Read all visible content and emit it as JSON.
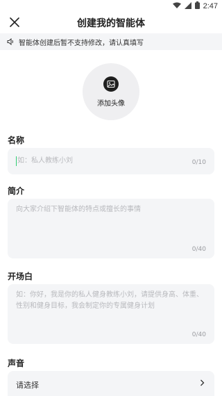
{
  "status_bar": {
    "time": "2:47"
  },
  "header": {
    "title": "创建我的智能体"
  },
  "notice": {
    "text": "智能体创建后暂不支持修改，请认真填写"
  },
  "avatar": {
    "label": "添加头像"
  },
  "name_field": {
    "label": "名称",
    "placeholder": "如：私人教练小刘",
    "count": "0/10"
  },
  "intro_field": {
    "label": "简介",
    "placeholder": "向大家介绍下智能体的特点或擅长的事情",
    "count": "0/40"
  },
  "opening_field": {
    "label": "开场白",
    "placeholder": "如：你好，我是你的私人健身教练小刘，请提供身高、体重、性别和健身目标，我会制定你的专属健身计划",
    "count": "0/40"
  },
  "voice_field": {
    "label": "声音",
    "value": "请选择"
  },
  "icons": [
    "wifi-icon",
    "signal-icon",
    "battery-icon",
    "close-icon",
    "speaker-icon",
    "image-icon",
    "chevron-right-icon"
  ]
}
